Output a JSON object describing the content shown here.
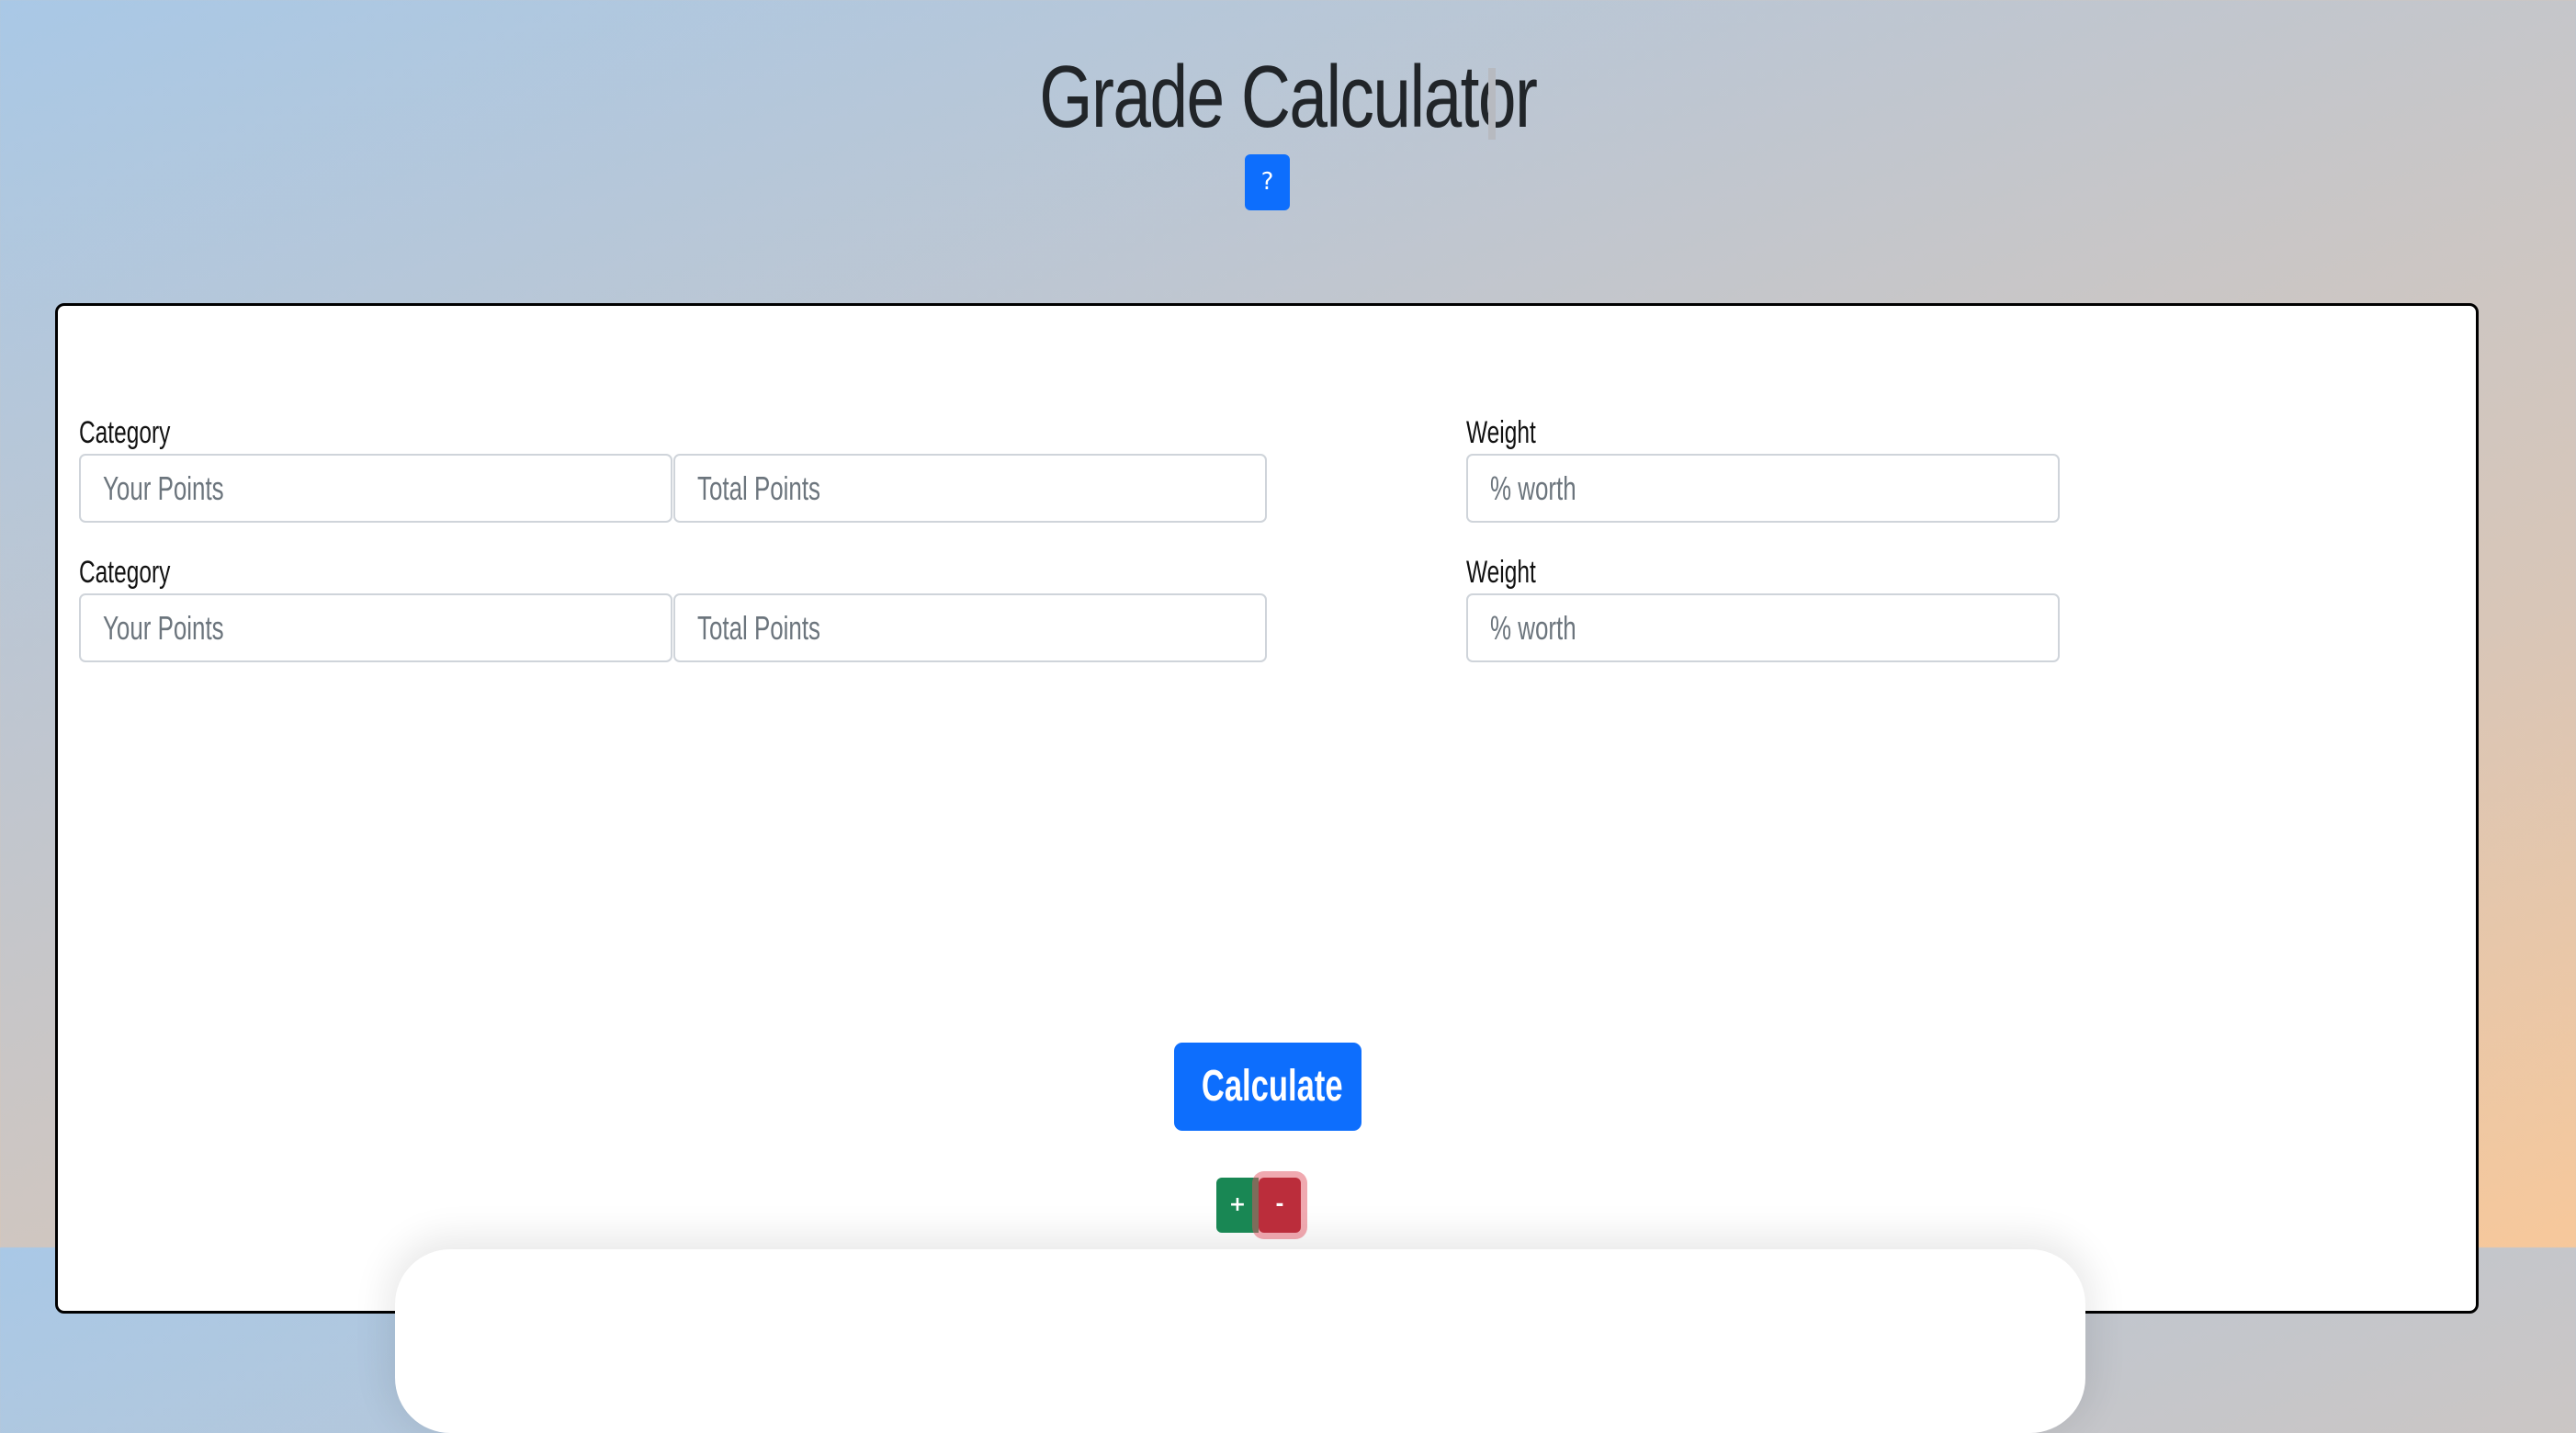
{
  "header": {
    "title": "Grade Calculator",
    "help_button_label": "?"
  },
  "form": {
    "rows": [
      {
        "category_label": "Category",
        "your_points_placeholder": "Your Points",
        "total_points_placeholder": "Total Points",
        "weight_label": "Weight",
        "weight_placeholder": "% worth"
      },
      {
        "category_label": "Category",
        "your_points_placeholder": "Your Points",
        "total_points_placeholder": "Total Points",
        "weight_label": "Weight",
        "weight_placeholder": "% worth"
      }
    ]
  },
  "actions": {
    "calculate_label": "Calculate",
    "add_row_label": "+",
    "remove_row_label": "-"
  },
  "colors": {
    "primary": "#0d6efd",
    "success": "#198754",
    "danger": "#bb2d3b",
    "background_start": "#a9c8e6",
    "background_end": "#f7c89b"
  }
}
